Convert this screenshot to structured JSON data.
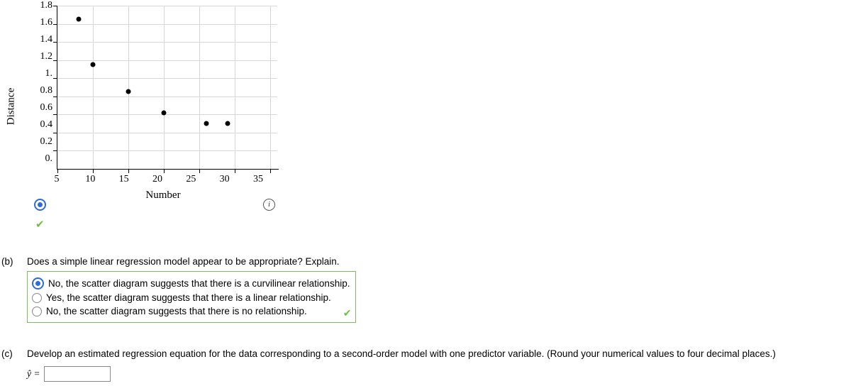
{
  "chart_data": {
    "type": "scatter",
    "title": "",
    "xlabel": "Number",
    "ylabel": "Distance",
    "xlim": [
      5,
      35
    ],
    "ylim": [
      0,
      1.8
    ],
    "xticks": [
      5,
      10,
      15,
      20,
      25,
      30,
      35
    ],
    "yticks": [
      0,
      0.2,
      0.4,
      0.6,
      0.8,
      1.0,
      1.2,
      1.4,
      1.6,
      1.8
    ],
    "points": [
      {
        "x": 8,
        "y": 1.65
      },
      {
        "x": 10,
        "y": 1.15
      },
      {
        "x": 15,
        "y": 0.85
      },
      {
        "x": 20,
        "y": 0.62
      },
      {
        "x": 26,
        "y": 0.5
      },
      {
        "x": 29,
        "y": 0.5
      }
    ]
  },
  "info_icon_char": "i",
  "partA": {
    "selected": true
  },
  "questions": {
    "b": {
      "label": "(b)",
      "prompt": "Does a simple linear regression model appear to be appropriate? Explain.",
      "options": [
        "No, the scatter diagram suggests that there is a curvilinear relationship.",
        "Yes, the scatter diagram suggests that there is a linear relationship.",
        "No, the scatter diagram suggests that there is no relationship."
      ],
      "selected_index": 0,
      "correct": true
    },
    "c": {
      "label": "(c)",
      "prompt": "Develop an estimated regression equation for the data corresponding to a second-order model with one predictor variable. (Round your numerical values to four decimal places.)",
      "yhat_symbol": "ŷ =",
      "answer_value": ""
    }
  }
}
